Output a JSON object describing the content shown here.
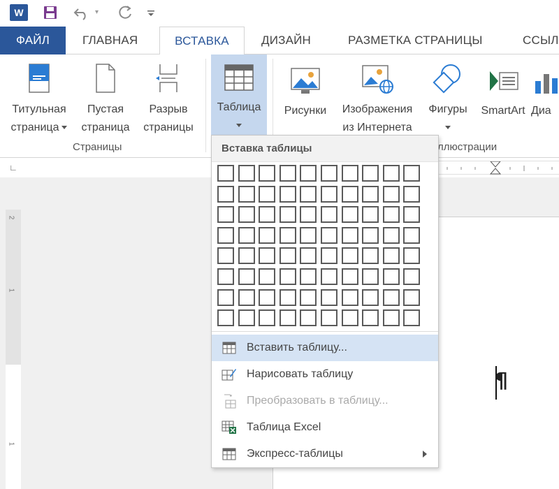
{
  "qat": {
    "app_logo": "W",
    "icons": [
      "word-logo",
      "save-icon",
      "undo-icon",
      "redo-icon",
      "customize-icon"
    ]
  },
  "tabs": [
    {
      "label": "ФАЙЛ",
      "id": "file"
    },
    {
      "label": "ГЛАВНАЯ",
      "id": "home"
    },
    {
      "label": "ВСТАВКА",
      "id": "insert",
      "active": true
    },
    {
      "label": "ДИЗАЙН",
      "id": "design"
    },
    {
      "label": "РАЗМЕТКА СТРАНИЦЫ",
      "id": "layout"
    },
    {
      "label": "ССЫЛ",
      "id": "references"
    }
  ],
  "ribbon": {
    "pages_group": {
      "label": "Страницы",
      "cover_page": {
        "line1": "Титульная",
        "line2": "страница"
      },
      "blank_page": {
        "line1": "Пустая",
        "line2": "страница"
      },
      "page_break": {
        "line1": "Разрыв",
        "line2": "страницы"
      }
    },
    "tables_group": {
      "table": {
        "line1": "Таблица"
      }
    },
    "illustrations_group": {
      "label": "ллюстрации",
      "pictures": {
        "line1": "Рисунки"
      },
      "online_pictures": {
        "line1": "Изображения",
        "line2": "из Интернета"
      },
      "shapes": {
        "line1": "Фигуры"
      },
      "smartart": {
        "line1": "SmartArt"
      },
      "chart": {
        "line1": "Диа"
      }
    }
  },
  "ruler": {
    "corner": "∟",
    "v_numbers": [
      "2",
      "1",
      "1"
    ]
  },
  "document": {
    "paragraph_mark": "¶"
  },
  "dropdown": {
    "title": "Вставка таблицы",
    "grid": {
      "columns": 10,
      "rows": 8
    },
    "items": [
      {
        "label": "Вставить таблицу...",
        "icon": "insert-table-icon",
        "highlighted": true,
        "disabled": false
      },
      {
        "label": "Нарисовать таблицу",
        "icon": "draw-table-icon",
        "highlighted": false,
        "disabled": false
      },
      {
        "label": "Преобразовать в таблицу...",
        "icon": "convert-table-icon",
        "highlighted": false,
        "disabled": true
      },
      {
        "label": "Таблица Excel",
        "icon": "excel-table-icon",
        "highlighted": false,
        "disabled": false
      },
      {
        "label": "Экспресс-таблицы",
        "icon": "quick-tables-icon",
        "highlighted": false,
        "disabled": false,
        "submenu": true
      }
    ]
  },
  "colors": {
    "accent": "#2b579a",
    "pressed": "#c5d7ee",
    "highlight": "#d5e3f4",
    "excel_green": "#217346"
  }
}
